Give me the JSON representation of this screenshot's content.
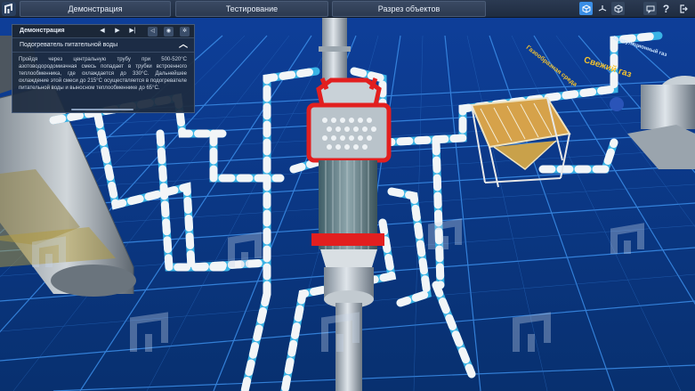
{
  "tabs": [
    {
      "label": "Демонстрация"
    },
    {
      "label": "Тестирование"
    },
    {
      "label": "Разрез объектов"
    }
  ],
  "toolbar": {
    "help_label": "?"
  },
  "panel": {
    "title": "Демонстрация",
    "section_title": "Подогреватель питательной воды",
    "description": "Пройдя через центральную трубу при 500-520°C азотоводородомиачная смесь попадает в трубки встроенного теплообменника, где охлаждается до 330°C. Дальнейшее охлаждение этой смеси до 215°C осуществляется в подогревателе питательной воды и выносном теплообменнике до 65°C."
  },
  "scene": {
    "label_gas": "Свежий газ",
    "label_circ": "Циркуляционный газ",
    "label_medium": "Газообразная среда"
  },
  "colors": {
    "background": "#0a3a8f",
    "grid": "#3b8de8",
    "pipe_white": "#e8edf2",
    "pipe_blue": "#4fc0e8",
    "cutaway_red": "#e21f1f",
    "accent": "#3a8ee6",
    "label_yellow": "#f2c230"
  },
  "icons": [
    "app-logo-icon",
    "cube-view-icon",
    "axes-icon",
    "box-icon",
    "chat-icon",
    "help-icon",
    "exit-icon",
    "play-icon",
    "prev-icon",
    "next-icon",
    "sound-icon",
    "record-icon",
    "settings-icon",
    "chevron-up-icon"
  ]
}
